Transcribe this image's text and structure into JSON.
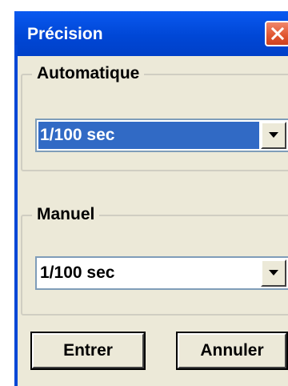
{
  "window": {
    "title": "Précision"
  },
  "groups": [
    {
      "label": "Automatique",
      "selected_value": "1/100 sec"
    },
    {
      "label": "Manuel",
      "selected_value": "1/100 sec"
    }
  ],
  "buttons": {
    "ok_label": "Entrer",
    "cancel_label": "Annuler"
  },
  "colors": {
    "titlebar": "#0047d6",
    "selection": "#316ac5",
    "dialog_bg": "#ece9d8",
    "close": "#e0542f"
  },
  "icons": {
    "close": "close-icon",
    "dropdown": "chevron-down-icon"
  }
}
